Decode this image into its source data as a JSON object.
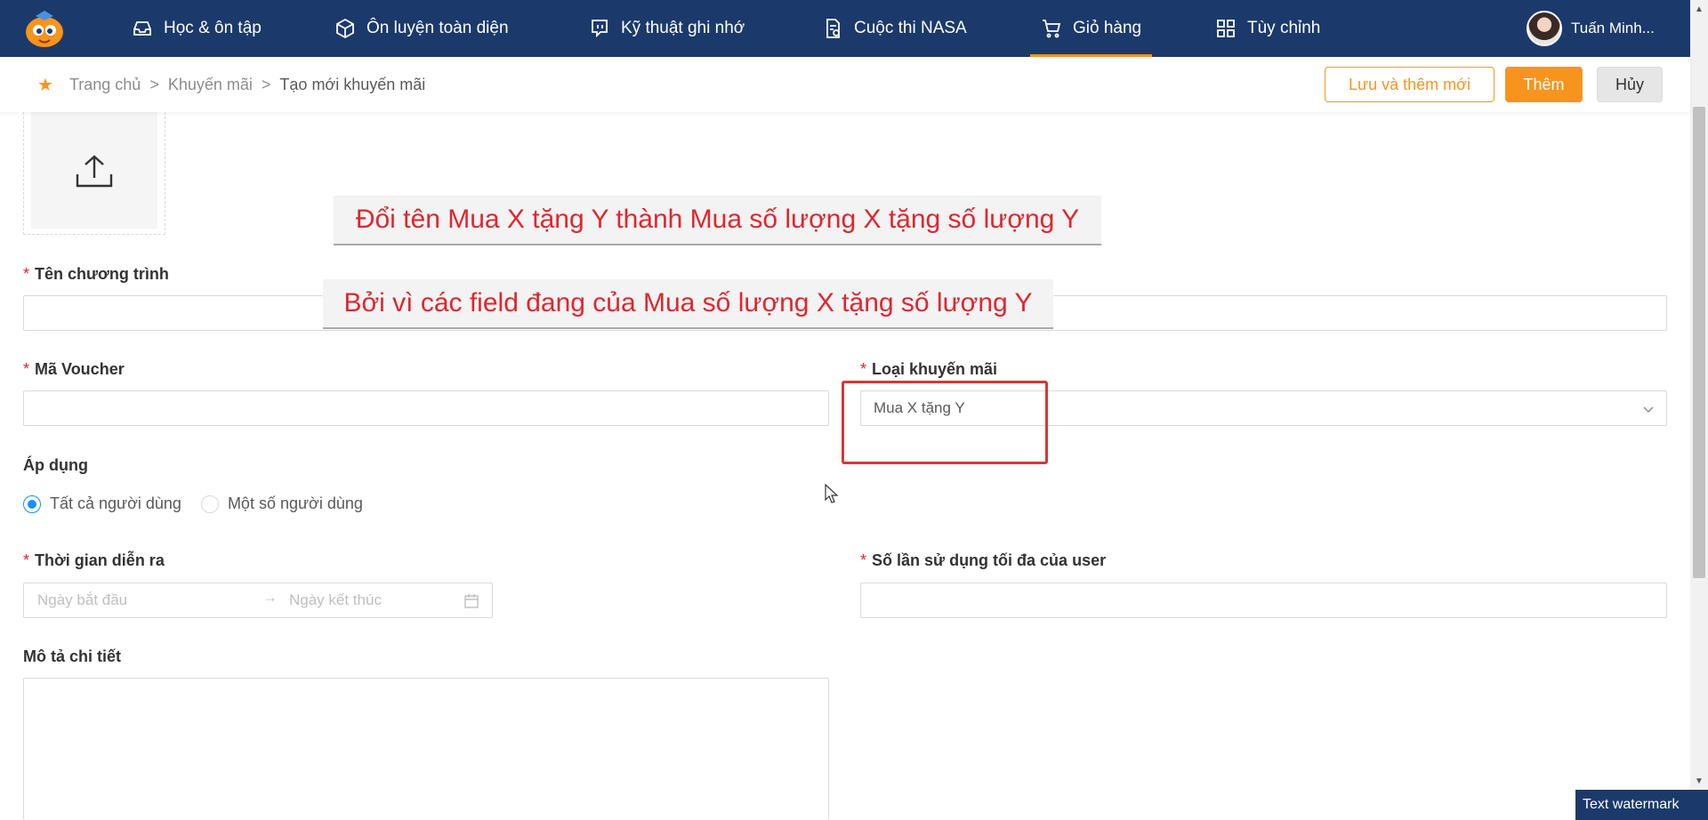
{
  "nav": {
    "items": [
      {
        "label": "Học & ôn tập",
        "icon": "inbox-icon"
      },
      {
        "label": "Ôn luyện toàn diện",
        "icon": "cube-icon"
      },
      {
        "label": "Kỹ thuật ghi nhớ",
        "icon": "chat-icon"
      },
      {
        "label": "Cuộc thi NASA",
        "icon": "document-check-icon"
      },
      {
        "label": "Giỏ hàng",
        "icon": "cart-icon",
        "active": true
      },
      {
        "label": "Tùy chỉnh",
        "icon": "grid-icon"
      }
    ],
    "user_name": "Tuấn Minh..."
  },
  "breadcrumb": {
    "home": "Trang chủ",
    "section": "Khuyến mãi",
    "current": "Tạo mới khuyến mãi",
    "separator": ">"
  },
  "actions": {
    "save_add": "Lưu và thêm mới",
    "add": "Thêm",
    "cancel": "Hủy"
  },
  "form": {
    "program_name_label": "Tên chương trình",
    "voucher_label": "Mã Voucher",
    "promo_type_label": "Loại khuyến mãi",
    "promo_type_value": "Mua X tặng Y",
    "apply_label": "Áp dụng",
    "apply_all": "Tất cả người dùng",
    "apply_some": "Một số người dùng",
    "time_label": "Thời gian diễn ra",
    "start_placeholder": "Ngày bắt đầu",
    "end_placeholder": "Ngày kết thúc",
    "range_separator": "→",
    "max_use_label": "Số lần sử dụng tối đa của user",
    "description_label": "Mô tả chi tiết"
  },
  "annotations": {
    "note1": "Đổi tên Mua X tặng Y thành Mua số lượng X tặng số lượng Y",
    "note2": "Bởi vì các field đang của Mua số lượng X tặng số lượng Y"
  },
  "watermark": "Text watermark",
  "colors": {
    "nav_bg": "#1b3a6b",
    "accent": "#f7941d",
    "required": "#e0262e",
    "radio": "#1890ff"
  }
}
